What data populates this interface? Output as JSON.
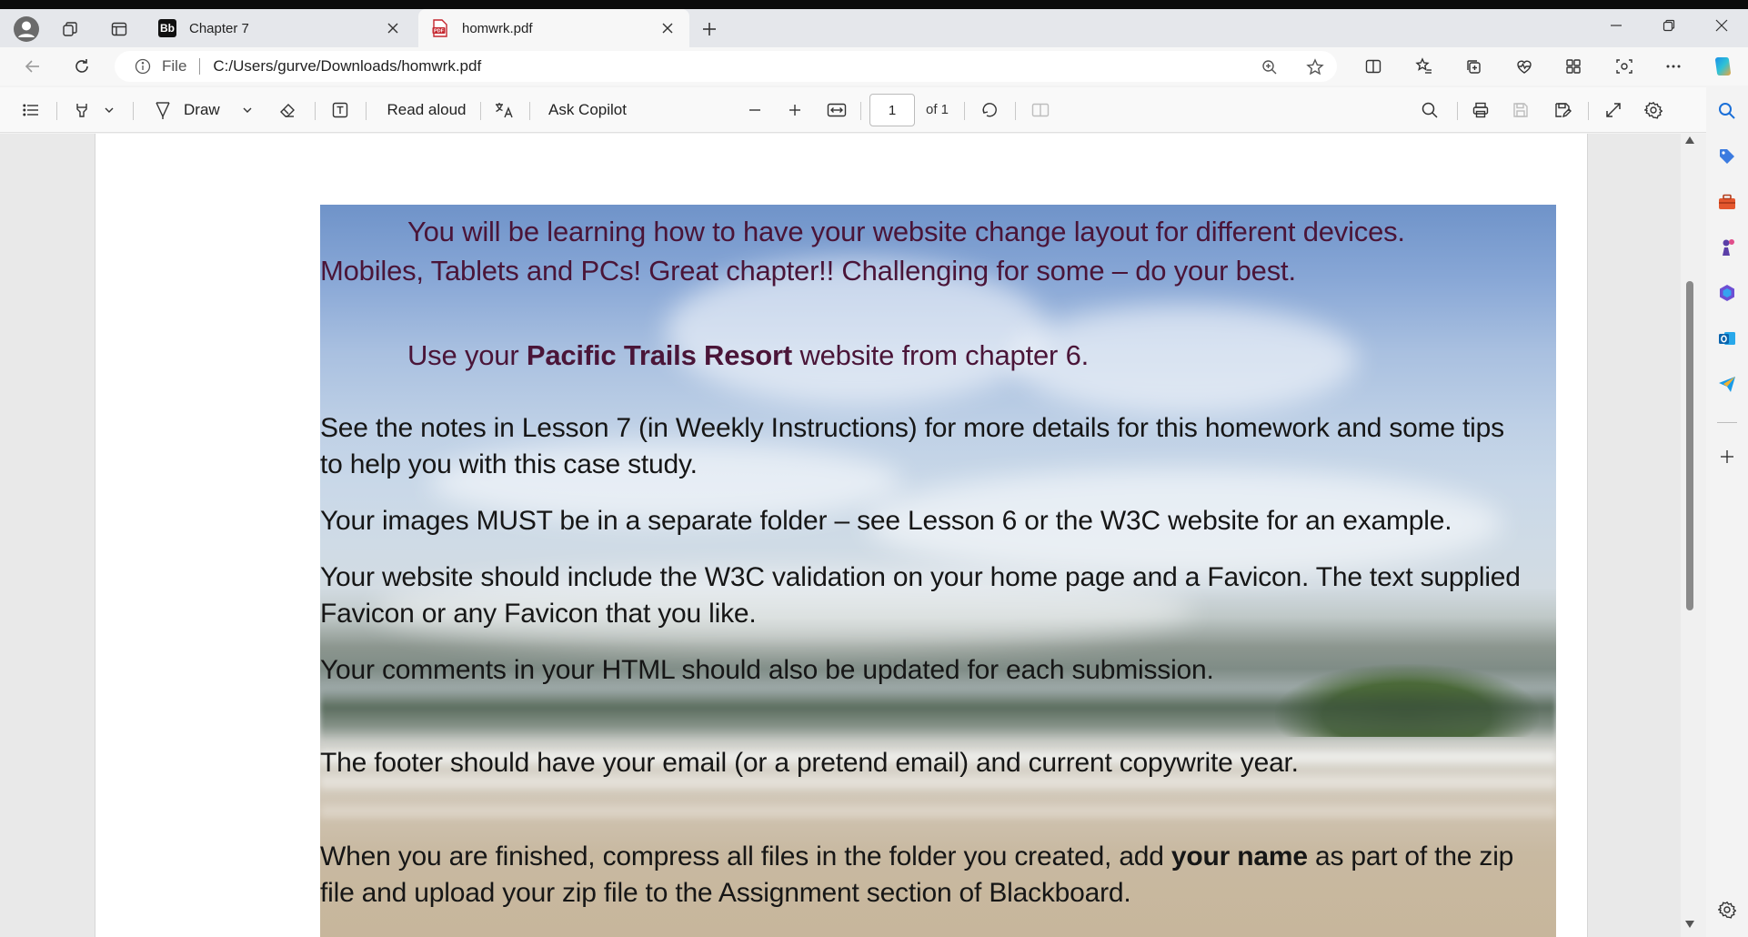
{
  "browser": {
    "tabs": [
      {
        "label": "Chapter 7",
        "favicon": "Bb",
        "active": false
      },
      {
        "label": "homwrk.pdf",
        "favicon": "pdf-icon",
        "active": true
      }
    ],
    "address": {
      "scheme": "File",
      "url": "C:/Users/gurve/Downloads/homwrk.pdf"
    }
  },
  "pdf_toolbar": {
    "draw_label": "Draw",
    "read_aloud_label": "Read aloud",
    "ask_copilot_label": "Ask Copilot",
    "page_current": "1",
    "page_total": "of 1"
  },
  "document": {
    "p1_line1": "You will be learning how to have your website change layout for different devices.",
    "p1_line2": "Mobiles, Tablets and PCs!  Great chapter!! Challenging for some – do your best.",
    "p2_pre": "Use your ",
    "p2_bold": "Pacific Trails Resort",
    "p2_post": " website from chapter 6.",
    "p3_line1": "See the notes in Lesson 7 (in Weekly Instructions) for more details for this homework and some tips",
    "p3_line2": "to help you with this case study.",
    "p4": "Your images MUST be in a separate folder – see Lesson 6 or the W3C website for an example.",
    "p5_line1": "Your website should include the W3C validation on your home page and a Favicon.  The text supplied",
    "p5_line2": "Favicon or any Favicon that you like.",
    "p6": "Your comments in your HTML should also be updated for each submission.",
    "p7": "The footer should have your email (or a pretend email) and current copywrite year.",
    "p8_pre": "When you are finished, compress all files in the folder you created, add ",
    "p8_bold": "your name",
    "p8_post": " as part of the zip",
    "p8_line2": "file and upload your zip file to the Assignment section of Blackboard."
  },
  "colors": {
    "tab_strip": "#e5e7eb",
    "heading_text": "#4a1538",
    "body_text": "#161616"
  }
}
